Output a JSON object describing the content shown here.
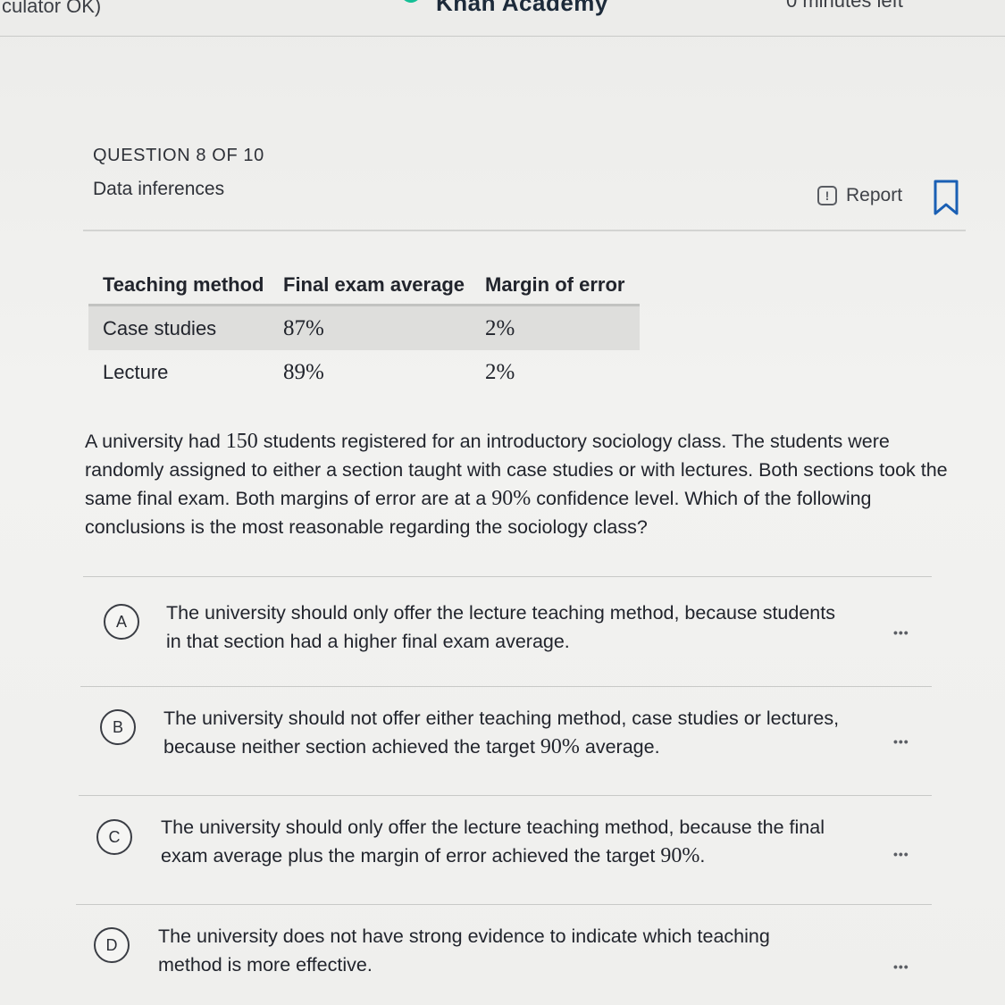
{
  "topbar": {
    "left_text": "culator OK)",
    "brand": "Khan Academy",
    "right_text": "0 minutes left"
  },
  "question": {
    "counter": "QUESTION 8 OF 10",
    "skill": "Data inferences",
    "report_label": "Report"
  },
  "table": {
    "headers": [
      "Teaching method",
      "Final exam average",
      "Margin of error"
    ],
    "rows": [
      {
        "method": "Case studies",
        "average": "87%",
        "margin": "2%"
      },
      {
        "method": "Lecture",
        "average": "89%",
        "margin": "2%"
      }
    ]
  },
  "prompt": {
    "part1": "A university had ",
    "num1": "150",
    "part2": " students registered for an introductory sociology class. The students were randomly assigned to either a section taught with case studies or with lectures. Both sections took the same final exam. Both margins of error are at a ",
    "num2": "90%",
    "part3": " confidence level. Which of the following conclusions is the most reasonable regarding the sociology class?"
  },
  "choices": [
    {
      "letter": "A",
      "text_before": "The university should only offer the lecture teaching method, because students in that section had a higher final exam average.",
      "num": "",
      "text_after": ""
    },
    {
      "letter": "B",
      "text_before": "The university should not offer either teaching method, case studies or lectures, because neither section achieved the target ",
      "num": "90%",
      "text_after": " average."
    },
    {
      "letter": "C",
      "text_before": "The university should only offer the lecture teaching method, because the final exam average plus the margin of error achieved the target ",
      "num": "90%",
      "text_after": "."
    },
    {
      "letter": "D",
      "text_before": "The university does not have strong evidence to indicate which teaching method is more effective.",
      "num": "",
      "text_after": ""
    }
  ],
  "more_label": "•••",
  "icons": {
    "report": "alert-square-icon",
    "bookmark": "bookmark-icon",
    "logo": "khan-academy-logo-icon",
    "more": "more-options-icon"
  },
  "colors": {
    "brand_green": "#14bf96",
    "text": "#21242c",
    "table_shade": "#dededc"
  }
}
